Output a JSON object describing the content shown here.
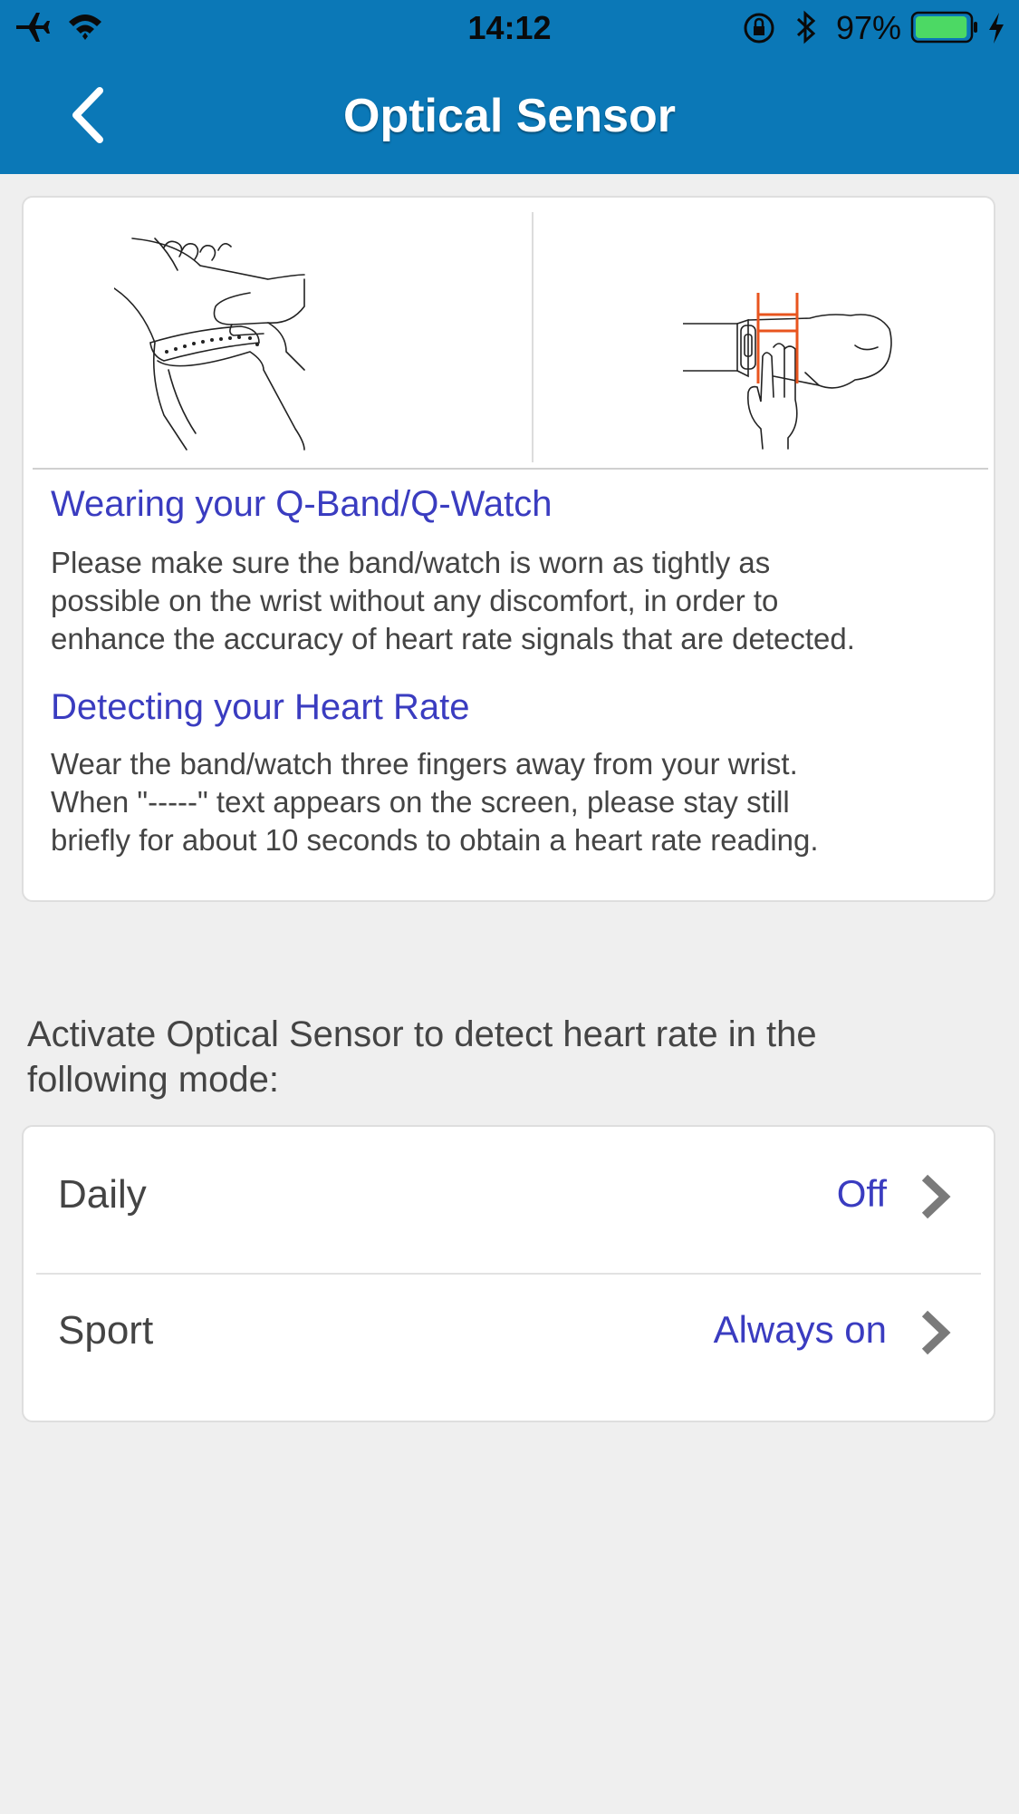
{
  "status_bar": {
    "time": "14:12",
    "battery_percent": "97%",
    "battery_level": 0.97,
    "icons": [
      "airplane-icon",
      "wifi-icon",
      "orientation-lock-icon",
      "bluetooth-icon",
      "battery-icon",
      "charging-icon"
    ]
  },
  "header": {
    "title": "Optical Sensor",
    "back_icon": "chevron-left-icon",
    "background_color": "#0b78b7"
  },
  "info_card": {
    "sections": [
      {
        "title": "Wearing your Q-Band/Q-Watch",
        "lines": [
          "Please make sure the band/watch is worn as tightly as",
          "possible on the wrist without any discomfort, in order to",
          "enhance the accuracy of heart rate signals that are detected."
        ]
      },
      {
        "title": "Detecting your Heart Rate",
        "lines": [
          "Wear the band/watch three fingers away from your wrist.",
          "When \"-----\" text appears on the screen, please stay still",
          "briefly for about 10 seconds to obtain a heart rate reading."
        ]
      }
    ]
  },
  "modes": {
    "prompt_lines": [
      "Activate Optical Sensor to detect heart rate in the",
      "following mode:"
    ],
    "rows": [
      {
        "label": "Daily",
        "value": "Off"
      },
      {
        "label": "Sport",
        "value": "Always on"
      }
    ]
  },
  "colors": {
    "accent_text": "#3a3cc0",
    "highlight_orange": "#e8541e",
    "battery_green": "#4cd964"
  }
}
